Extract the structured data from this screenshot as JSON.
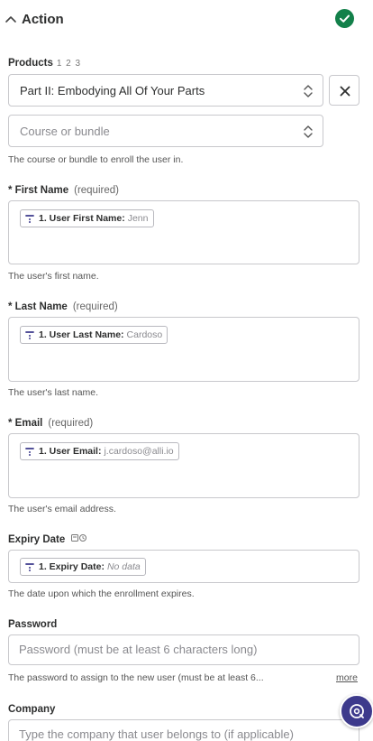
{
  "header": {
    "title": "Action",
    "status": "complete"
  },
  "products": {
    "label": "Products",
    "steps": "1 2 3",
    "selected": "Part II: Embodying All Of Your Parts"
  },
  "course": {
    "placeholder": "Course or bundle",
    "help": "The course or bundle to enroll the user in."
  },
  "first_name": {
    "label": "* First Name",
    "required": "(required)",
    "pill_key": "1. User First Name:",
    "pill_value": "Jenn",
    "help": "The user's first name."
  },
  "last_name": {
    "label": "* Last Name",
    "required": "(required)",
    "pill_key": "1. User Last Name:",
    "pill_value": "Cardoso",
    "help": "The user's last name."
  },
  "email": {
    "label": "* Email",
    "required": "(required)",
    "pill_key": "1. User Email:",
    "pill_value": "j.cardoso@alli.io",
    "help": "The user's email address."
  },
  "expiry": {
    "label": "Expiry Date",
    "pill_key": "1. Expiry Date:",
    "pill_value": "No data",
    "help": "The date upon which the enrollment expires."
  },
  "password": {
    "label": "Password",
    "placeholder": "Password (must be at least 6 characters long)",
    "help": "The password to assign to the new user (must be at least 6...",
    "more": "more"
  },
  "company": {
    "label": "Company",
    "placeholder": "Type the company that user belongs to (if applicable)"
  },
  "colors": {
    "accent": "#3d3a8c",
    "success": "#13804a"
  }
}
